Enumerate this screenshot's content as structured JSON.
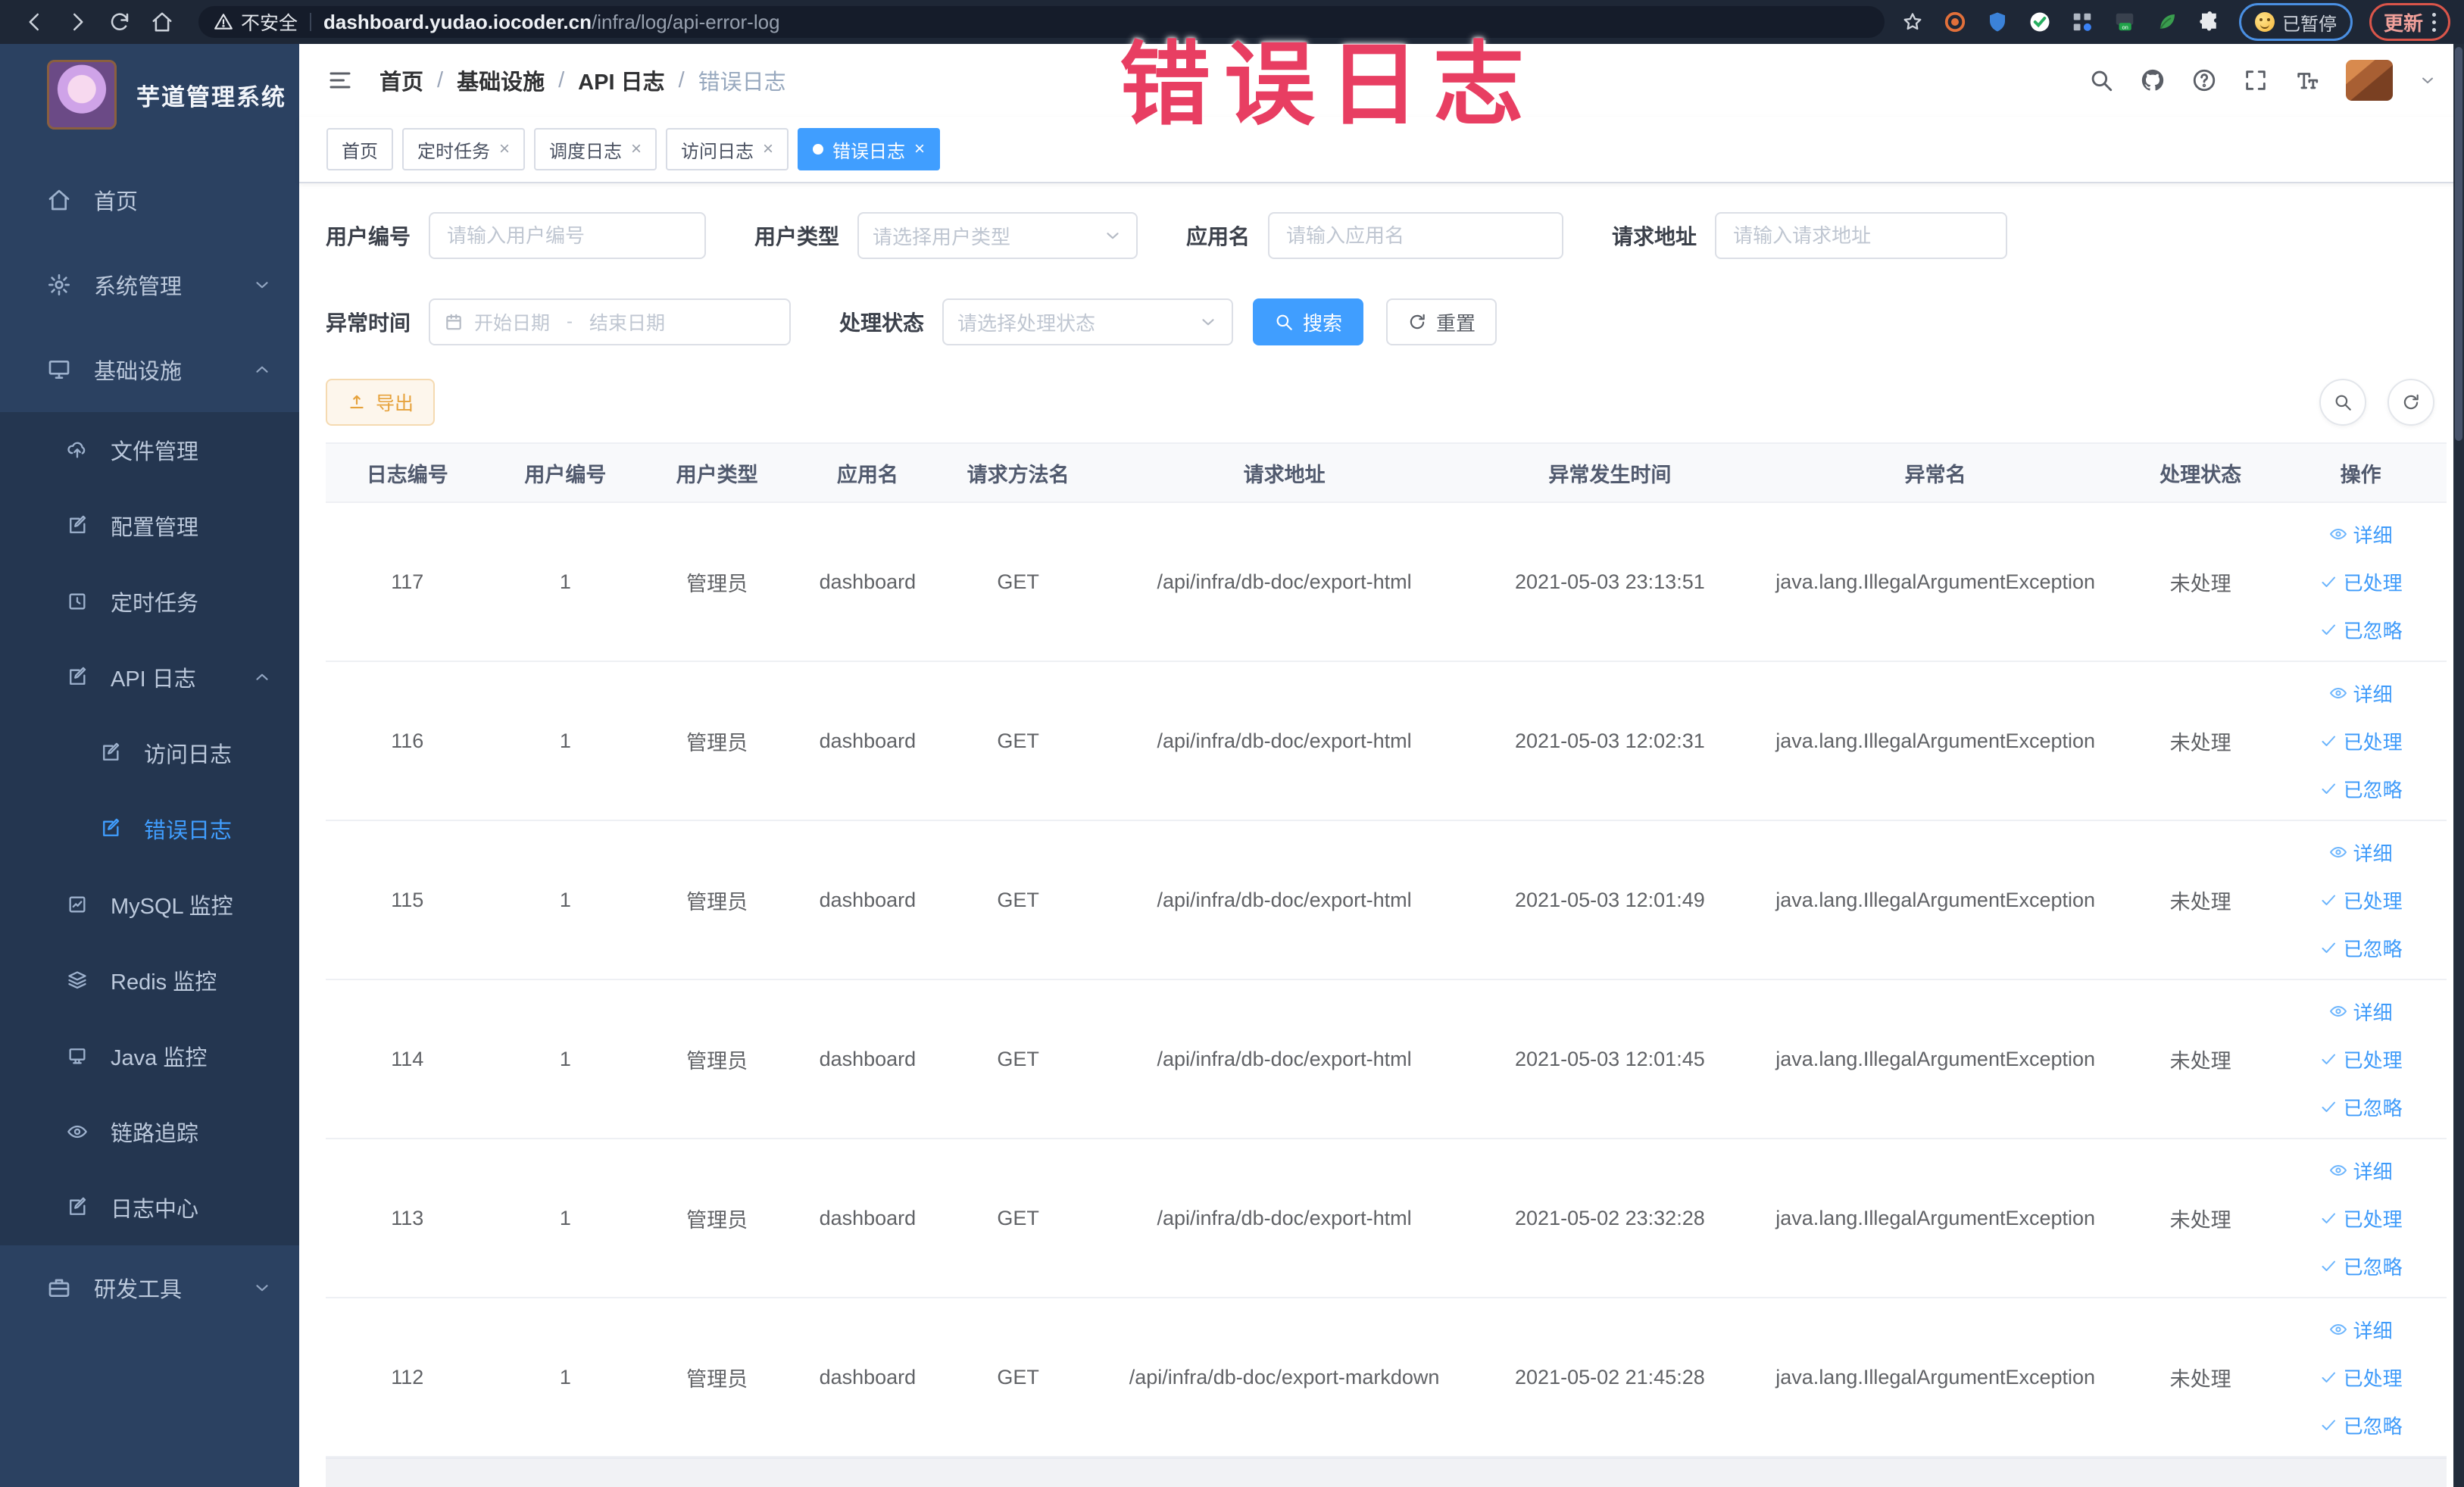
{
  "colors": {
    "accent": "#409eff",
    "warning": "#e6a23c",
    "annotation_pink": "#e83e62",
    "chrome_bg": "#1e2736",
    "sidebar_bg": "#2b4161",
    "submenu_bg": "#243650",
    "active_tab_bg": "#409eff"
  },
  "annotation": {
    "text": "错误日志"
  },
  "browser": {
    "security_label": "不安全",
    "url_host": "dashboard.yudao.iocoder.cn",
    "url_path": "/infra/log/api-error-log",
    "paused_chip": "已暂停",
    "update_button": "更新",
    "nav_icons": [
      "back-icon",
      "forward-icon",
      "reload-icon",
      "home-icon"
    ],
    "extension_icons": [
      "orange-extension-icon",
      "blue-shield-extension-icon",
      "green-check-extension-icon",
      "grid-extension-icon",
      "vpn-on-extension-icon",
      "green-leaf-extension-icon",
      "puzzle-extensions-icon"
    ]
  },
  "sidebar": {
    "title": "芋道管理系统",
    "items": [
      {
        "label": "首页",
        "icon": "home-icon",
        "level": 1
      },
      {
        "label": "系统管理",
        "icon": "gear-icon",
        "level": 1,
        "chevron": "down"
      },
      {
        "label": "基础设施",
        "icon": "monitor-icon",
        "level": 1,
        "chevron": "up"
      },
      {
        "label": "文件管理",
        "icon": "upload-cloud-icon",
        "level": 2
      },
      {
        "label": "配置管理",
        "icon": "edit-square-icon",
        "level": 2
      },
      {
        "label": "定时任务",
        "icon": "clock-square-icon",
        "level": 2
      },
      {
        "label": "API 日志",
        "icon": "edit-square-icon",
        "level": 2,
        "chevron": "up"
      },
      {
        "label": "访问日志",
        "icon": "edit-square-icon",
        "level": 3
      },
      {
        "label": "错误日志",
        "icon": "edit-square-icon",
        "level": 3,
        "active": true
      },
      {
        "label": "MySQL 监控",
        "icon": "chart-square-icon",
        "level": 2
      },
      {
        "label": "Redis 监控",
        "icon": "layers-icon",
        "level": 2
      },
      {
        "label": "Java 监控",
        "icon": "screen-icon",
        "level": 2
      },
      {
        "label": "链路追踪",
        "icon": "eye-icon",
        "level": 2
      },
      {
        "label": "日志中心",
        "icon": "edit-square-icon",
        "level": 2
      },
      {
        "label": "研发工具",
        "icon": "toolbox-icon",
        "level": 1,
        "chevron": "down"
      }
    ]
  },
  "header": {
    "breadcrumb": [
      "首页",
      "基础设施",
      "API 日志",
      "错误日志"
    ],
    "icons": [
      "search-icon",
      "github-icon",
      "help-icon",
      "fullscreen-icon",
      "font-size-icon"
    ]
  },
  "tabs": [
    {
      "label": "首页",
      "closable": false,
      "active": false
    },
    {
      "label": "定时任务",
      "closable": true,
      "active": false
    },
    {
      "label": "调度日志",
      "closable": true,
      "active": false
    },
    {
      "label": "访问日志",
      "closable": true,
      "active": false
    },
    {
      "label": "错误日志",
      "closable": true,
      "active": true
    }
  ],
  "filters": {
    "user_id": {
      "label": "用户编号",
      "placeholder": "请输入用户编号"
    },
    "user_type": {
      "label": "用户类型",
      "placeholder": "请选择用户类型"
    },
    "app_name": {
      "label": "应用名",
      "placeholder": "请输入应用名"
    },
    "request_url": {
      "label": "请求地址",
      "placeholder": "请输入请求地址"
    },
    "exception_time": {
      "label": "异常时间",
      "start_placeholder": "开始日期",
      "separator": "-",
      "end_placeholder": "结束日期"
    },
    "process_status": {
      "label": "处理状态",
      "placeholder": "请选择处理状态"
    },
    "search_button": "搜索",
    "reset_button": "重置"
  },
  "toolbar": {
    "export_button": "导出"
  },
  "table": {
    "columns": [
      "日志编号",
      "用户编号",
      "用户类型",
      "应用名",
      "请求方法名",
      "请求地址",
      "异常发生时间",
      "异常名",
      "处理状态",
      "操作"
    ],
    "actions": [
      "详细",
      "已处理",
      "已忽略"
    ],
    "rows": [
      {
        "id": "117",
        "user_id": "1",
        "user_type": "管理员",
        "app": "dashboard",
        "method": "GET",
        "url": "/api/infra/db-doc/export-html",
        "time": "2021-05-03 23:13:51",
        "exception": "java.lang.IllegalArgumentException",
        "status": "未处理"
      },
      {
        "id": "116",
        "user_id": "1",
        "user_type": "管理员",
        "app": "dashboard",
        "method": "GET",
        "url": "/api/infra/db-doc/export-html",
        "time": "2021-05-03 12:02:31",
        "exception": "java.lang.IllegalArgumentException",
        "status": "未处理"
      },
      {
        "id": "115",
        "user_id": "1",
        "user_type": "管理员",
        "app": "dashboard",
        "method": "GET",
        "url": "/api/infra/db-doc/export-html",
        "time": "2021-05-03 12:01:49",
        "exception": "java.lang.IllegalArgumentException",
        "status": "未处理"
      },
      {
        "id": "114",
        "user_id": "1",
        "user_type": "管理员",
        "app": "dashboard",
        "method": "GET",
        "url": "/api/infra/db-doc/export-html",
        "time": "2021-05-03 12:01:45",
        "exception": "java.lang.IllegalArgumentException",
        "status": "未处理"
      },
      {
        "id": "113",
        "user_id": "1",
        "user_type": "管理员",
        "app": "dashboard",
        "method": "GET",
        "url": "/api/infra/db-doc/export-html",
        "time": "2021-05-02 23:32:28",
        "exception": "java.lang.IllegalArgumentException",
        "status": "未处理"
      },
      {
        "id": "112",
        "user_id": "1",
        "user_type": "管理员",
        "app": "dashboard",
        "method": "GET",
        "url": "/api/infra/db-doc/export-markdown",
        "time": "2021-05-02 21:45:28",
        "exception": "java.lang.IllegalArgumentException",
        "status": "未处理"
      }
    ]
  }
}
